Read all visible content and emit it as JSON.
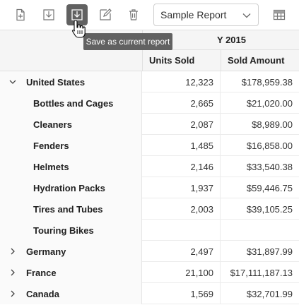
{
  "toolbar": {
    "buttons": [
      {
        "name": "new-report",
        "icon": "new-report-icon"
      },
      {
        "name": "save-report",
        "icon": "save-icon"
      },
      {
        "name": "save-as-current-report",
        "icon": "save-as-icon"
      },
      {
        "name": "rename-report",
        "icon": "edit-icon"
      },
      {
        "name": "remove-report",
        "icon": "trash-icon"
      }
    ],
    "report_select_value": "Sample Report",
    "grid_icon": "grid-icon"
  },
  "tooltip": {
    "text": "Save as current report"
  },
  "grid": {
    "year_header": "Y 2015",
    "columns": [
      "Units Sold",
      "Sold Amount"
    ],
    "rows": [
      {
        "label": "United States",
        "level": "parent",
        "expanded": true,
        "units": "12,323",
        "amount": "$178,959.38"
      },
      {
        "label": "Bottles and Cages",
        "level": "child",
        "units": "2,665",
        "amount": "$21,020.00"
      },
      {
        "label": "Cleaners",
        "level": "child",
        "units": "2,087",
        "amount": "$8,989.00"
      },
      {
        "label": "Fenders",
        "level": "child",
        "units": "1,485",
        "amount": "$16,858.00"
      },
      {
        "label": "Helmets",
        "level": "child",
        "units": "2,146",
        "amount": "$33,540.38"
      },
      {
        "label": "Hydration Packs",
        "level": "child",
        "units": "1,937",
        "amount": "$59,446.75"
      },
      {
        "label": "Tires and Tubes",
        "level": "child",
        "units": "2,003",
        "amount": "$39,105.25"
      },
      {
        "label": "Touring Bikes",
        "level": "child",
        "units": "",
        "amount": ""
      },
      {
        "label": "Germany",
        "level": "parent",
        "expanded": false,
        "units": "2,497",
        "amount": "$31,897.99"
      },
      {
        "label": "France",
        "level": "parent",
        "expanded": false,
        "units": "21,100",
        "amount": "$17,111,187.13"
      },
      {
        "label": "Canada",
        "level": "parent",
        "expanded": false,
        "units": "1,569",
        "amount": "$32,701.99"
      }
    ]
  },
  "colors": {
    "active_button": "#616161",
    "tooltip_bg": "#616161",
    "header_bg": "#f5f5f5"
  }
}
